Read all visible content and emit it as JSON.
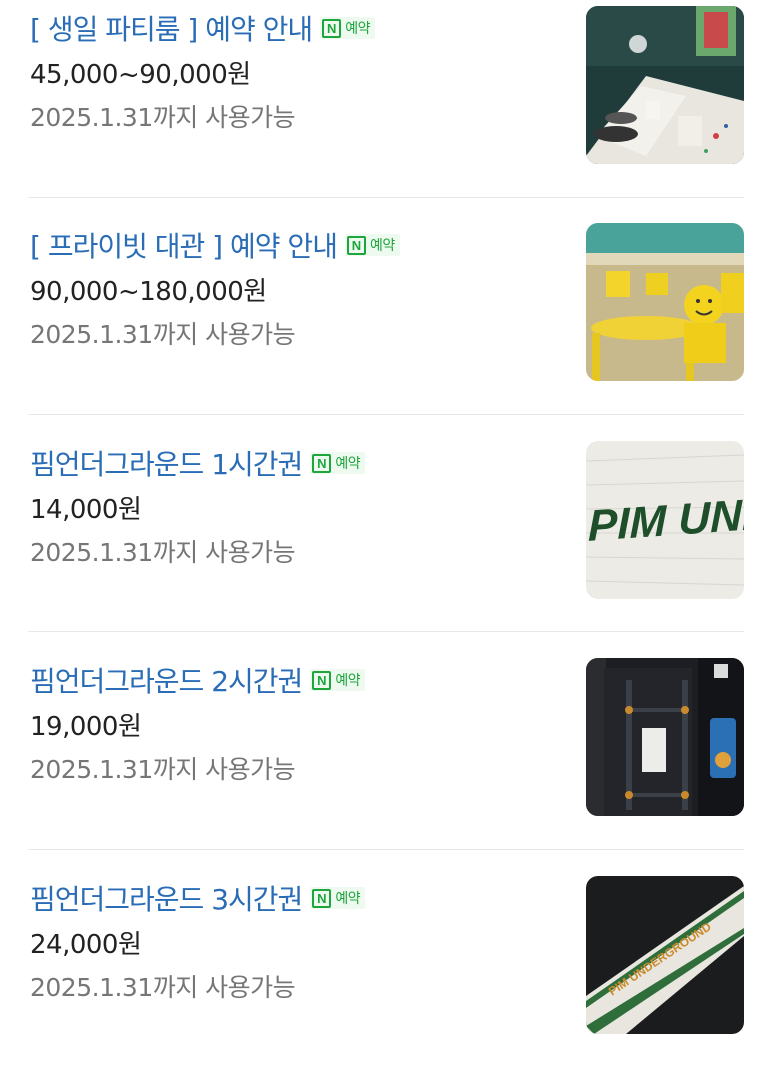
{
  "items": [
    {
      "title": "[ 생일 파티룸 ] 예약 안내",
      "badge": "예약",
      "price": "45,000~90,000원",
      "valid": "2025.1.31까지 사용가능",
      "image": "party-room-photo"
    },
    {
      "title": "[ 프라이빗 대관 ] 예약 안내",
      "badge": "예약",
      "price": "90,000~180,000원",
      "valid": "2025.1.31까지 사용가능",
      "image": "private-rental-photo"
    },
    {
      "title": "핌언더그라운드 1시간권",
      "badge": "예약",
      "price": "14,000원",
      "valid": "2025.1.31까지 사용가능",
      "image": "pim-wall-photo",
      "sign_text": "PIM UNDE"
    },
    {
      "title": "핌언더그라운드 2시간권",
      "badge": "예약",
      "price": "19,000원",
      "valid": "2025.1.31까지 사용가능",
      "image": "entrance-photo"
    },
    {
      "title": "핌언더그라운드 3시간권",
      "badge": "예약",
      "price": "24,000원",
      "valid": "2025.1.31까지 사용가능",
      "image": "sign-photo",
      "sign_text": "PIM UNDERGROUND"
    }
  ],
  "badge_letter": "N",
  "colors": {
    "title": "#2a6db6",
    "naver_green": "#1ca63b",
    "price": "#222222",
    "sub": "#767676"
  }
}
